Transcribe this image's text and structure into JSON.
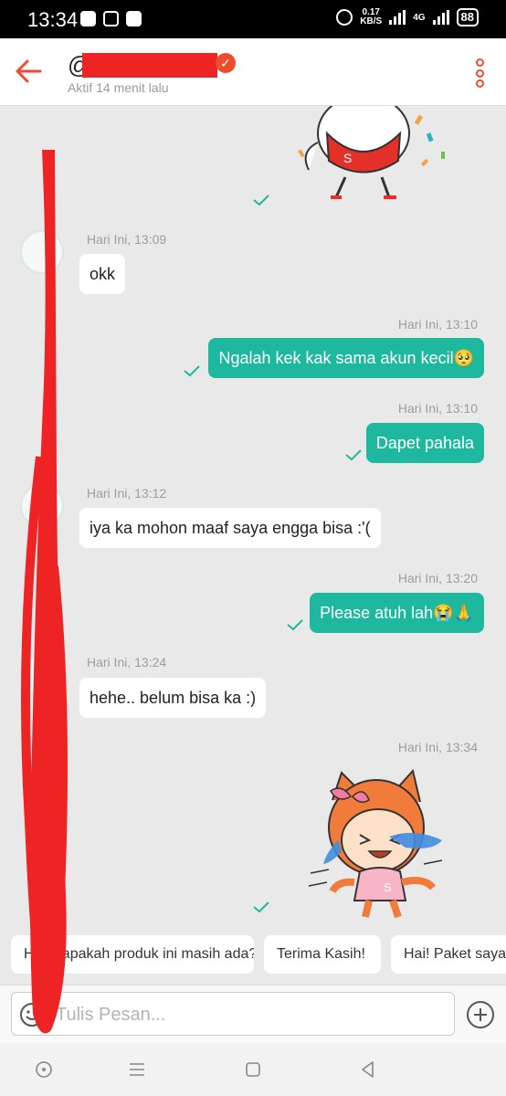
{
  "status_bar": {
    "time": "13:34",
    "net_speed_value": "0.17",
    "net_speed_unit": "KB/S",
    "network": "4G",
    "battery": "88"
  },
  "header": {
    "title": "@",
    "last_seen": "Aktif 14 menit lalu"
  },
  "messages": [
    {
      "type": "sticker",
      "direction": "out",
      "sticker": "chicken-sticker"
    },
    {
      "type": "text",
      "direction": "in",
      "timestamp": "Hari Ini, 13:09",
      "text": "okk"
    },
    {
      "type": "text",
      "direction": "out",
      "timestamp": "Hari Ini, 13:10",
      "text": "Ngalah kek kak sama akun kecil🥺"
    },
    {
      "type": "text",
      "direction": "out",
      "timestamp": "Hari Ini, 13:10",
      "text": "Dapet pahala"
    },
    {
      "type": "text",
      "direction": "in",
      "timestamp": "Hari Ini, 13:12",
      "text": "iya ka mohon maaf saya engga bisa :'("
    },
    {
      "type": "text",
      "direction": "out",
      "timestamp": "Hari Ini, 13:20",
      "text": "Please atuh lah😭🙏"
    },
    {
      "type": "text",
      "direction": "in",
      "timestamp": "Hari Ini, 13:24",
      "text": "hehe.. belum bisa ka :)"
    },
    {
      "type": "sticker",
      "direction": "out",
      "timestamp": "Hari Ini, 13:34",
      "sticker": "crying-girl-sticker"
    }
  ],
  "quick_replies": [
    "Halo, apakah produk ini masih ada?",
    "Terima Kasih!",
    "Hai! Paket saya"
  ],
  "composer": {
    "placeholder": "Tulis Pesan..."
  },
  "colors": {
    "accent": "#ee4d2d",
    "outgoing_bubble": "#1eb89f",
    "redaction": "#ee2424"
  }
}
